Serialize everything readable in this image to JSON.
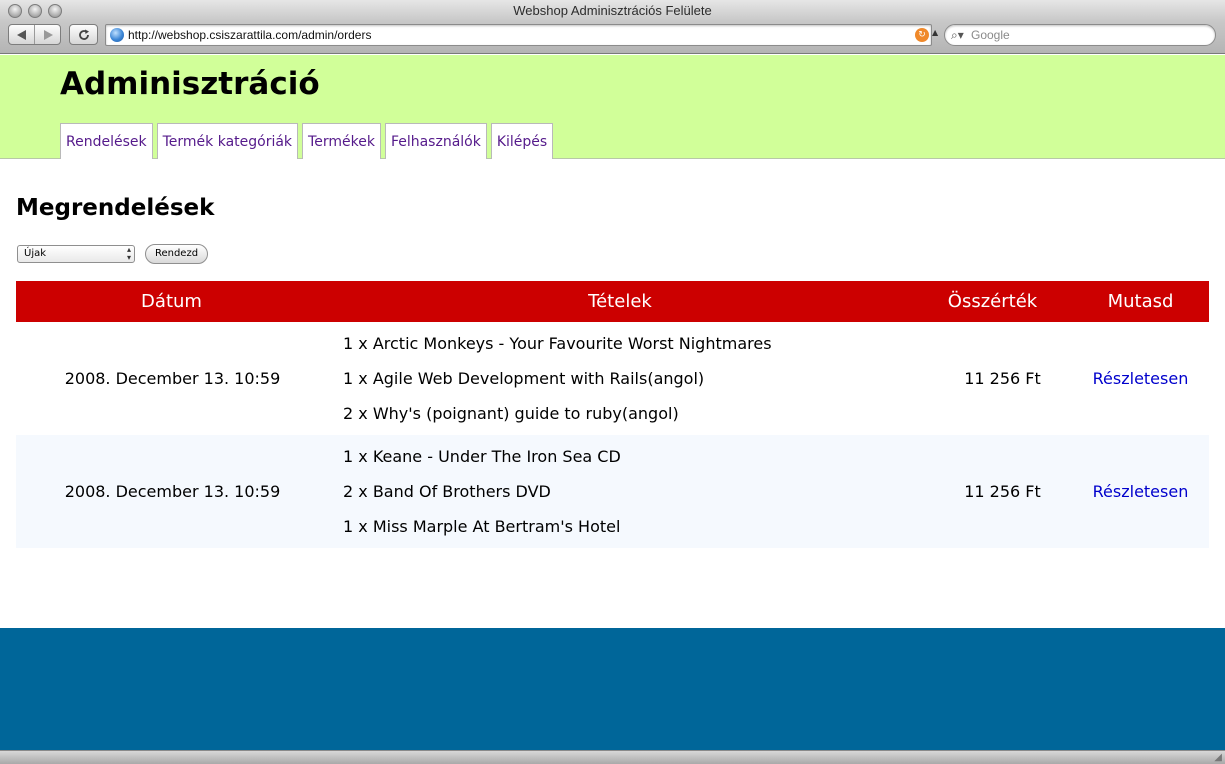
{
  "window": {
    "title": "Webshop Adminisztrációs Felülete"
  },
  "browser": {
    "url": "http://webshop.csiszarattila.com/admin/orders",
    "search_placeholder": "Google"
  },
  "header": {
    "title": "Adminisztráció",
    "tabs": [
      {
        "label": "Rendelések"
      },
      {
        "label": "Termék kategóriák"
      },
      {
        "label": "Termékek"
      },
      {
        "label": "Felhasználók"
      },
      {
        "label": "Kilépés"
      }
    ]
  },
  "main": {
    "heading": "Megrendelések",
    "filter": {
      "selected": "Újak",
      "button_label": "Rendezd"
    },
    "table": {
      "columns": [
        "Dátum",
        "Tételek",
        "Összérték",
        "Mutasd"
      ],
      "rows": [
        {
          "date": "2008. December 13. 10:59",
          "items": [
            "1 x Arctic Monkeys - Your Favourite Worst Nightmares",
            "1 x Agile Web Development with Rails(angol)",
            "2 x Why's (poignant) guide to ruby(angol)"
          ],
          "total": "11 256 Ft",
          "action": "Részletesen"
        },
        {
          "date": "2008. December 13. 10:59",
          "items": [
            "1 x Keane - Under The Iron Sea CD",
            "2 x Band Of Brothers DVD",
            "1 x Miss Marple At Bertram's Hotel"
          ],
          "total": "11 256 Ft",
          "action": "Részletesen"
        }
      ]
    }
  },
  "colors": {
    "header_bg": "#d1ff99",
    "table_header_bg": "#cc0000",
    "footer_bg": "#006699",
    "link": "#0000cc",
    "tab_link": "#551a8b"
  },
  "icons": {
    "back": "arrow-left-icon",
    "forward": "arrow-right-icon",
    "reload": "reload-icon",
    "site": "globe-icon",
    "feed": "rss-icon",
    "search": "magnifier-icon"
  }
}
